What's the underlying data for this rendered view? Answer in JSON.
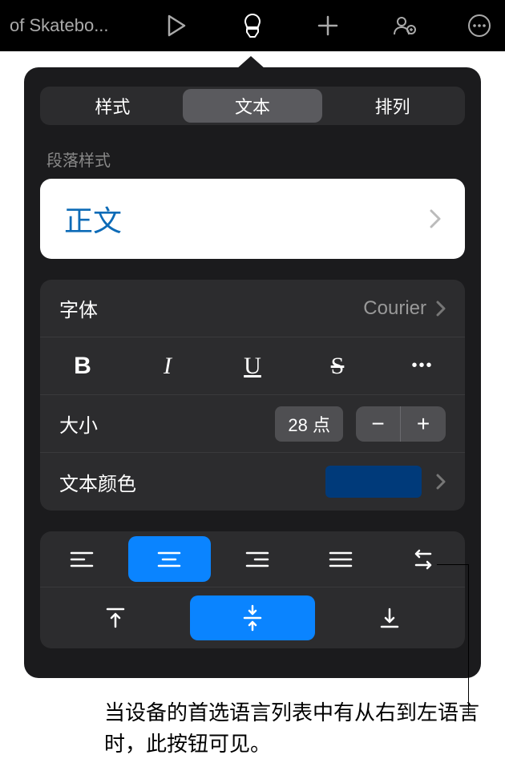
{
  "topbar": {
    "doc_title": "of Skatebo..."
  },
  "tabs": {
    "style": "样式",
    "text": "文本",
    "arrange": "排列"
  },
  "section": {
    "paragraph_style_label": "段落样式",
    "paragraph_style_value": "正文"
  },
  "font": {
    "label": "字体",
    "value": "Courier",
    "more": "•••"
  },
  "size": {
    "label": "大小",
    "value": "28 点",
    "minus": "−",
    "plus": "+"
  },
  "text_color": {
    "label": "文本颜色",
    "value": "#003a7a"
  },
  "callout": {
    "text": "当设备的首选语言列表中有从右到左语言时，此按钮可见。"
  }
}
